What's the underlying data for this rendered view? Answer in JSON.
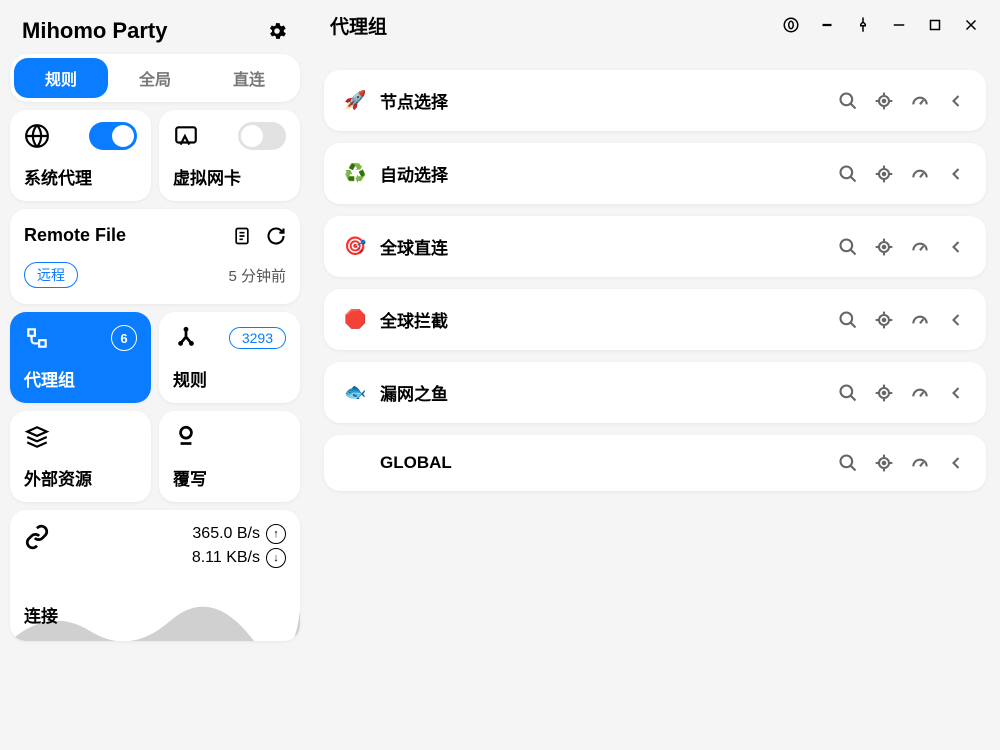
{
  "app": {
    "title": "Mihomo Party"
  },
  "tabs": {
    "rule": "规则",
    "global": "全局",
    "direct": "直连"
  },
  "proxy": {
    "system": {
      "label": "系统代理",
      "on": true
    },
    "tun": {
      "label": "虚拟网卡",
      "on": false
    }
  },
  "file": {
    "title": "Remote File",
    "tag": "远程",
    "time": "5 分钟前"
  },
  "nav": {
    "proxyGroup": {
      "label": "代理组",
      "count": "6"
    },
    "rules": {
      "label": "规则",
      "count": "3293"
    },
    "resources": {
      "label": "外部资源"
    },
    "override": {
      "label": "覆写"
    }
  },
  "conn": {
    "label": "连接",
    "up": "365.0 B/s",
    "down": "8.11 KB/s"
  },
  "main": {
    "title": "代理组"
  },
  "groups": [
    {
      "emoji": "🚀",
      "name": "节点选择"
    },
    {
      "emoji": "♻️",
      "name": "自动选择"
    },
    {
      "emoji": "🎯",
      "name": "全球直连"
    },
    {
      "emoji": "🛑",
      "name": "全球拦截"
    },
    {
      "emoji": "🐟",
      "name": "漏网之鱼"
    },
    {
      "emoji": "",
      "name": "GLOBAL"
    }
  ]
}
